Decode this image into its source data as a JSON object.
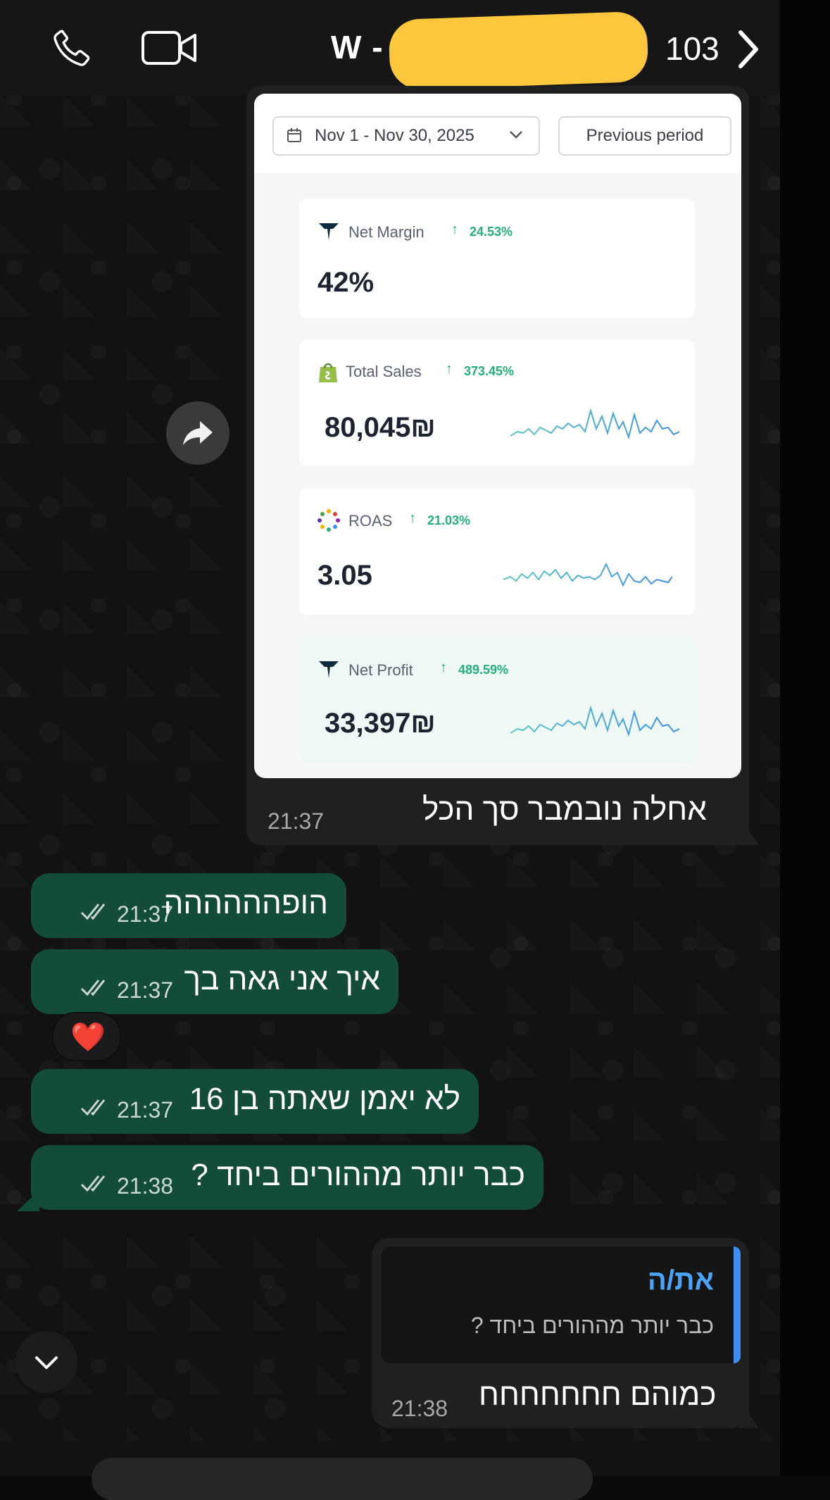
{
  "header": {
    "title_prefix": "W -",
    "count": "103",
    "call_icon": "phone-icon",
    "video_icon": "video-camera-icon",
    "forward_icon": "chevron-right-icon"
  },
  "dashboard": {
    "date_range": "Nov 1 - Nov 30, 2025",
    "compare_button": "Previous period",
    "metrics": [
      {
        "label": "Net Margin",
        "change": "24.53%",
        "value": "42%",
        "icon": "triple-whale-logo-icon",
        "sparkline": false
      },
      {
        "label": "Total Sales",
        "change": "373.45%",
        "value": "80,045₪",
        "icon": "shopify-bag-icon",
        "sparkline": true
      },
      {
        "label": "ROAS",
        "change": "21.03%",
        "value": "3.05",
        "icon": "dotted-circle-icon",
        "sparkline": true
      },
      {
        "label": "Net Profit",
        "change": "489.59%",
        "value": "33,397₪",
        "icon": "triple-whale-logo-icon",
        "sparkline": true
      }
    ]
  },
  "incoming": {
    "caption": "אחלה נובמבר סך הכל",
    "time": "21:37"
  },
  "outgoing": [
    {
      "text": "הופהההההה",
      "time": "21:37"
    },
    {
      "text": "איך אני גאה בך",
      "time": "21:37"
    },
    {
      "text": "לא יאמן שאתה בן 16",
      "time": "21:37"
    },
    {
      "text": "כבר יותר מההורים ביחד ?",
      "time": "21:38"
    }
  ],
  "reaction": "❤️",
  "reply": {
    "quoted_author": "את/ה",
    "quoted_text": "כבר יותר מההורים ביחד ?",
    "text": "כמוהם חחחחחחח",
    "time": "21:38"
  },
  "colors": {
    "outgoing_bubble": "#144d37",
    "incoming_bubble": "#202020",
    "accent_green": "#23b07a",
    "redaction": "#fcc63d",
    "reply_accent": "#3d8ef0"
  }
}
